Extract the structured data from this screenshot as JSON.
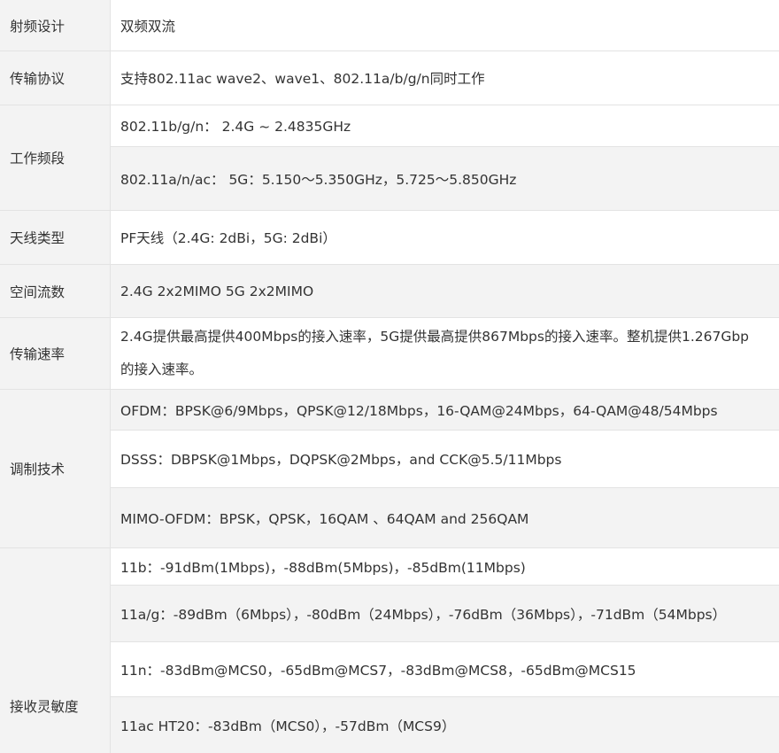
{
  "rows": [
    {
      "label": "射频设计",
      "values": [
        "双频双流"
      ]
    },
    {
      "label": "传输协议",
      "values": [
        "支持802.11ac wave2、wave1、802.11a/b/g/n同时工作"
      ]
    },
    {
      "label": "工作频段",
      "values": [
        "802.11b/g/n： 2.4G ~ 2.4835GHz",
        "802.11a/n/ac： 5G：5.150～5.350GHz，5.725～5.850GHz"
      ]
    },
    {
      "label": "天线类型",
      "values": [
        "PF天线（2.4G: 2dBi，5G: 2dBi）"
      ]
    },
    {
      "label": "空间流数",
      "values": [
        "2.4G 2x2MIMO  5G 2x2MIMO"
      ]
    },
    {
      "label": "传输速率",
      "values": [
        "2.4G提供最高提供400Mbps的接入速率，5G提供最高提供867Mbps的接入速率。整机提供1.267Gbp的接入速率。"
      ]
    },
    {
      "label": "调制技术",
      "values": [
        "OFDM：BPSK@6/9Mbps，QPSK@12/18Mbps，16-QAM@24Mbps，64-QAM@48/54Mbps",
        "DSSS：DBPSK@1Mbps，DQPSK@2Mbps，and CCK@5.5/11Mbps",
        "MIMO-OFDM：BPSK，QPSK，16QAM 、64QAM and 256QAM"
      ]
    },
    {
      "label": "接收灵敏度",
      "values": [
        "11b：-91dBm(1Mbps)，-88dBm(5Mbps)，-85dBm(11Mbps)",
        "11a/g：-89dBm（6Mbps），-80dBm（24Mbps），-76dBm（36Mbps），-71dBm（54Mbps）",
        "11n：-83dBm@MCS0，-65dBm@MCS7，-83dBm@MCS8，-65dBm@MCS15",
        "11ac HT20：-83dBm（MCS0），-57dBm（MCS9）"
      ]
    }
  ],
  "colors": {
    "label_bg": "#f3f3f3",
    "border": "#e3e3e3",
    "text": "#333333"
  }
}
